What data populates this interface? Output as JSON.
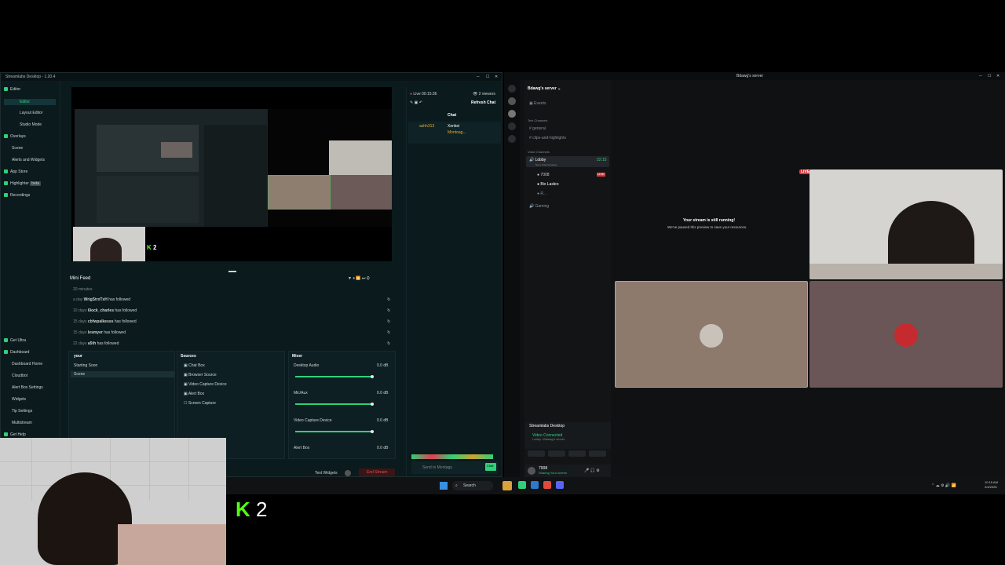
{
  "streamlabs": {
    "title": "Streamlabs Desktop - 1.20.4",
    "sidebar": [
      {
        "label": "Editor",
        "type": "section"
      },
      {
        "label": "Editor",
        "type": "item",
        "active": true
      },
      {
        "label": "Layout Editor",
        "type": "item"
      },
      {
        "label": "Studio Mode",
        "type": "item"
      },
      {
        "label": "Overlays",
        "type": "section"
      },
      {
        "label": "Scene",
        "type": "item"
      },
      {
        "label": "Alerts and Widgets",
        "type": "item"
      },
      {
        "label": "App Store",
        "type": "section"
      },
      {
        "label": "Highlighter",
        "type": "section"
      },
      {
        "label": "Recordings",
        "type": "section"
      }
    ],
    "highlighter_badge": "beta",
    "sidebar_bottom": [
      {
        "label": "Get Ultra",
        "type": "section"
      },
      {
        "label": "Dashboard",
        "type": "section"
      },
      {
        "label": "Dashboard Home",
        "type": "item"
      },
      {
        "label": "Cloudbot",
        "type": "item"
      },
      {
        "label": "Alert Box Settings",
        "type": "item"
      },
      {
        "label": "Widgets",
        "type": "item"
      },
      {
        "label": "Tip Settings",
        "type": "item"
      },
      {
        "label": "Multistream",
        "type": "item"
      },
      {
        "label": "Get Help",
        "type": "section"
      }
    ],
    "preview_overlay_text": "2",
    "mini_feed": {
      "title": "Mini Feed",
      "faded_row": "20 minutes",
      "rows": [
        {
          "time": "a day",
          "user": "WrigStrxTxH",
          "action": "has followed"
        },
        {
          "time": "10 days",
          "user": "6lock_charles",
          "action": "has followed"
        },
        {
          "time": "15 days",
          "user": "cbfwpalkesss",
          "action": "has followed"
        },
        {
          "time": "15 days",
          "user": "lesmyer",
          "action": "has followed"
        },
        {
          "time": "22 days",
          "user": "a5th",
          "action": "has followed"
        }
      ]
    },
    "scenes": {
      "title": "your",
      "items": [
        "Starting Soon",
        "Scene"
      ]
    },
    "sources": {
      "title": "Sources",
      "items": [
        "Chat Box",
        "Browser Source",
        "Video Capture Device",
        "Alert Box",
        "Screen Capture"
      ]
    },
    "mixer": {
      "title": "Mixer",
      "channels": [
        {
          "name": "Desktop Audio",
          "db": "0.0 dB",
          "level": 0.97
        },
        {
          "name": "Mic/Aux",
          "db": "0.0 dB",
          "level": 0.97
        },
        {
          "name": "Video Capture Device",
          "db": "0.0 dB",
          "level": 0.97
        },
        {
          "name": "Alert Box",
          "db": "0.0 dB",
          "level": 0.97
        }
      ]
    },
    "footer": {
      "test_widgets": "Test Widgets",
      "end_stream": "End Stream"
    },
    "chat": {
      "live": "Live 00:15:36",
      "viewers": "2 viewers",
      "refresh": "Refresh Chat",
      "title": "Chat",
      "messages": [
        {
          "user": "Xenkei",
          "text": ""
        },
        {
          "user": "Montoag...",
          "text": ""
        }
      ],
      "badge_user": "ashh313",
      "chat_button": "Chat",
      "send_label": "Send to Montagu"
    }
  },
  "discord": {
    "title": "Bdawg's server",
    "server_name": "Bdawg's server",
    "events": "Events",
    "text_category": "Text Channels",
    "text_channels": [
      "general",
      "clips-and-highlights"
    ],
    "voice_category": "Voice Channels",
    "voice_channels": [
      {
        "name": "Lobby",
        "time": "22:15",
        "topic": "Set a channel status"
      },
      {
        "name": "Gaming",
        "time": ""
      }
    ],
    "voice_users": [
      {
        "name": "7008",
        "live": true
      },
      {
        "name": "Bix Lasleo",
        "live": false
      },
      {
        "name": "R...",
        "live": false
      }
    ],
    "live_badge": "LIVE",
    "stream_message_title": "Your stream is still running!",
    "stream_message_sub": "We've paused this preview to save your resources.",
    "app": {
      "name": "Streamlabs Desktop",
      "status": "Video Connected",
      "sub": "Lobby / Bdawg's server"
    },
    "user": {
      "name": "7008",
      "status": "Sharing Your screen"
    }
  },
  "taskbar": {
    "search": "Search",
    "time": "10:15 AM",
    "date": "2/4/2025"
  },
  "webcam_overlay": {
    "kick_number": "2"
  },
  "colors": {
    "accent": "#2fd07a",
    "kick": "#53fc18",
    "live": "#e0383e",
    "bg": "#0b1a1d"
  }
}
